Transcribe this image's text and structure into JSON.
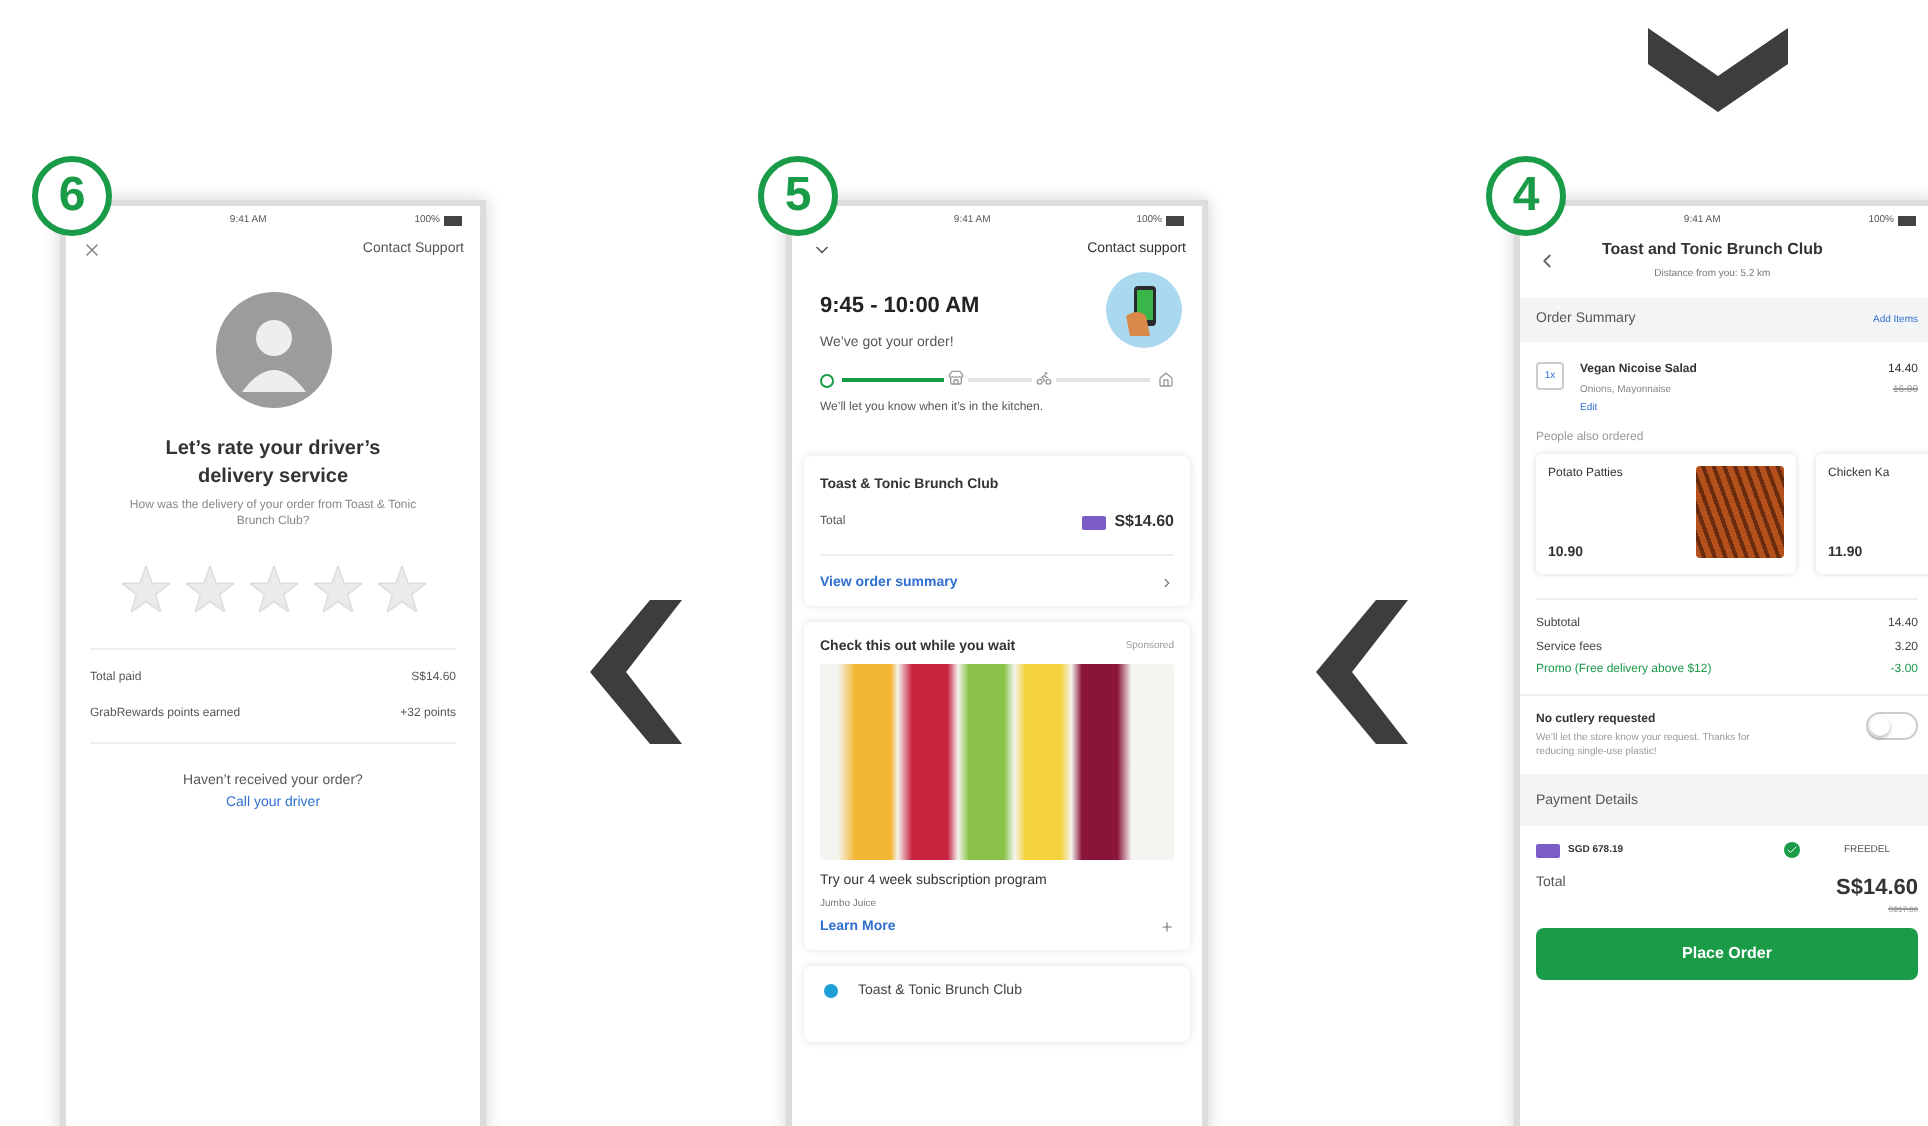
{
  "screens": [
    {
      "kind": "rating",
      "badge": "6",
      "status": {
        "time": "9:41 AM",
        "battery": "100%"
      },
      "support": "Contact Support",
      "heading": "Let’s rate your driver’s delivery service",
      "question": "How was the delivery of your order from Toast & Tonic Brunch Club?",
      "stars": 0,
      "rows": [
        {
          "label": "Total paid",
          "value": "S$14.60"
        },
        {
          "label": "GrabRewards points earned",
          "value": "+32 points"
        }
      ],
      "prompt": "Haven’t received your order?",
      "link": "Call your driver"
    },
    {
      "kind": "tracking",
      "badge": "5",
      "status": {
        "time": "9:41 AM",
        "battery": "100%"
      },
      "support": "Contact support",
      "time_range": "9:45 - 10:00 AM",
      "status_text": "We’ve got your order!",
      "progress": {
        "level": 0.33
      },
      "note": "We’ll let you know when it’s in the kitchen.",
      "order_card": {
        "restaurant": "Toast & Tonic Brunch Club",
        "total_label": "Total",
        "total": "S$14.60",
        "link": "View order summary"
      },
      "promo": {
        "title": "Check this out while you wait",
        "tag": "Sponsored",
        "caption": "Try our 4 week subscription program",
        "brand": "Jumbo Juice",
        "link": "Learn More"
      },
      "footer_item": "Toast & Tonic Brunch Club"
    },
    {
      "kind": "checkout",
      "badge": "4",
      "status": {
        "time": "9:41 AM",
        "battery": "100%"
      },
      "title": "Toast and Tonic Brunch Club",
      "subtitle": "Distance from you: 5.2 km",
      "summary_label": "Order Summary",
      "add_link": "Add Items",
      "items": [
        {
          "qty": "1x",
          "name": "Vegan Nicoise Salad",
          "options": "Onions, Mayonnaise",
          "edit": "Edit",
          "price": "14.40",
          "old_price": "16.00"
        }
      ],
      "also_label": "People also ordered",
      "suggestions": [
        {
          "name": "Potato Patties",
          "price": "10.90"
        },
        {
          "name": "Chicken Ka",
          "price": "11.90"
        }
      ],
      "fees": [
        {
          "kind": "charge",
          "label": "Subtotal",
          "value": "14.40"
        },
        {
          "kind": "charge",
          "label": "Service fees",
          "value": "3.20"
        },
        {
          "kind": "discount",
          "label": "Promo (Free delivery above $12)",
          "value": "-3.00"
        }
      ],
      "cutlery": {
        "title": "No cutlery requested",
        "note": "We’ll let the store know your request. Thanks for reducing single-use plastic!",
        "on": false
      },
      "payment_label": "Payment Details",
      "payment": {
        "method": "SGD 678.19",
        "promo_code": "FREEDEL"
      },
      "total_label": "Total",
      "total": "S$14.60",
      "old_total": "S$17.60",
      "button": "Place Order"
    }
  ]
}
